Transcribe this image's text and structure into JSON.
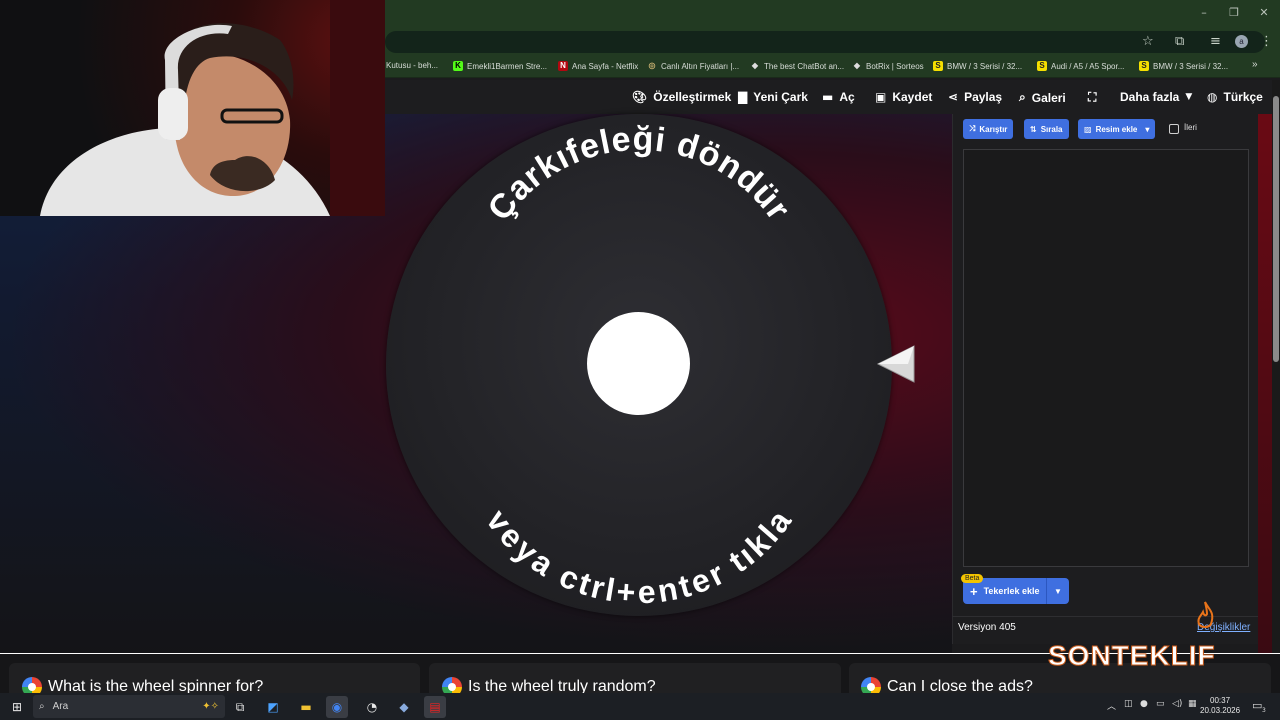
{
  "browser": {
    "window_controls": [
      "–",
      "❐",
      "✕"
    ],
    "profile_initial": "a",
    "bookmarks": [
      {
        "label": "Kutusu - beh...",
        "icon": "",
        "icon_bg": "#223a22"
      },
      {
        "label": "Emekli1Barmen Stre...",
        "icon": "K",
        "icon_bg": "#53fc18"
      },
      {
        "label": "Ana Sayfa - Netflix",
        "icon": "N",
        "icon_bg": "#b20710"
      },
      {
        "label": "Canlı Altın Fiyatları |...",
        "icon": "◎",
        "icon_bg": "#8a7a40"
      },
      {
        "label": "The best ChatBot an...",
        "icon": "◆",
        "icon_bg": "#dddddd"
      },
      {
        "label": "BotRix | Sorteos",
        "icon": "◆",
        "icon_bg": "#dddddd"
      },
      {
        "label": "BMW / 3 Serisi / 32...",
        "icon": "S",
        "icon_bg": "#f5e000"
      },
      {
        "label": "Audi / A5 / A5 Spor...",
        "icon": "S",
        "icon_bg": "#f5e000"
      },
      {
        "label": "BMW / 3 Serisi / 32...",
        "icon": "S",
        "icon_bg": "#f5e000"
      }
    ],
    "more_bookmarks": "»"
  },
  "nav": {
    "customize": "Özelleştirmek",
    "new_wheel": "Yeni Çark",
    "open": "Aç",
    "save": "Kaydet",
    "share": "Paylaş",
    "gallery": "Galeri",
    "more": "Daha fazla",
    "language": "Türkçe"
  },
  "wheel": {
    "top_text": "Çarkıfeleği döndür",
    "bottom_text": "veya ctrl+enter tıkla"
  },
  "panel": {
    "shuffle": "Karıştır",
    "sort": "Sırala",
    "add_image": "Resim ekle",
    "advanced": "İleri",
    "beta": "Beta",
    "add_wheel": "Tekerlek ekle",
    "version": "Versiyon 405",
    "changes": "Değişiklikler"
  },
  "faq": [
    {
      "title": "What is the wheel spinner for?"
    },
    {
      "title": "Is the wheel truly random?"
    },
    {
      "title": "Can I close the ads?"
    }
  ],
  "watermark": "SONTEKLIF",
  "taskbar": {
    "search_placeholder": "Ara",
    "time": "00:37",
    "date": "20.03.2026",
    "notifications": "3"
  },
  "colors": {
    "accent": "#3f6fe0",
    "chrome": "#223a22",
    "link": "#7fb0ff"
  }
}
